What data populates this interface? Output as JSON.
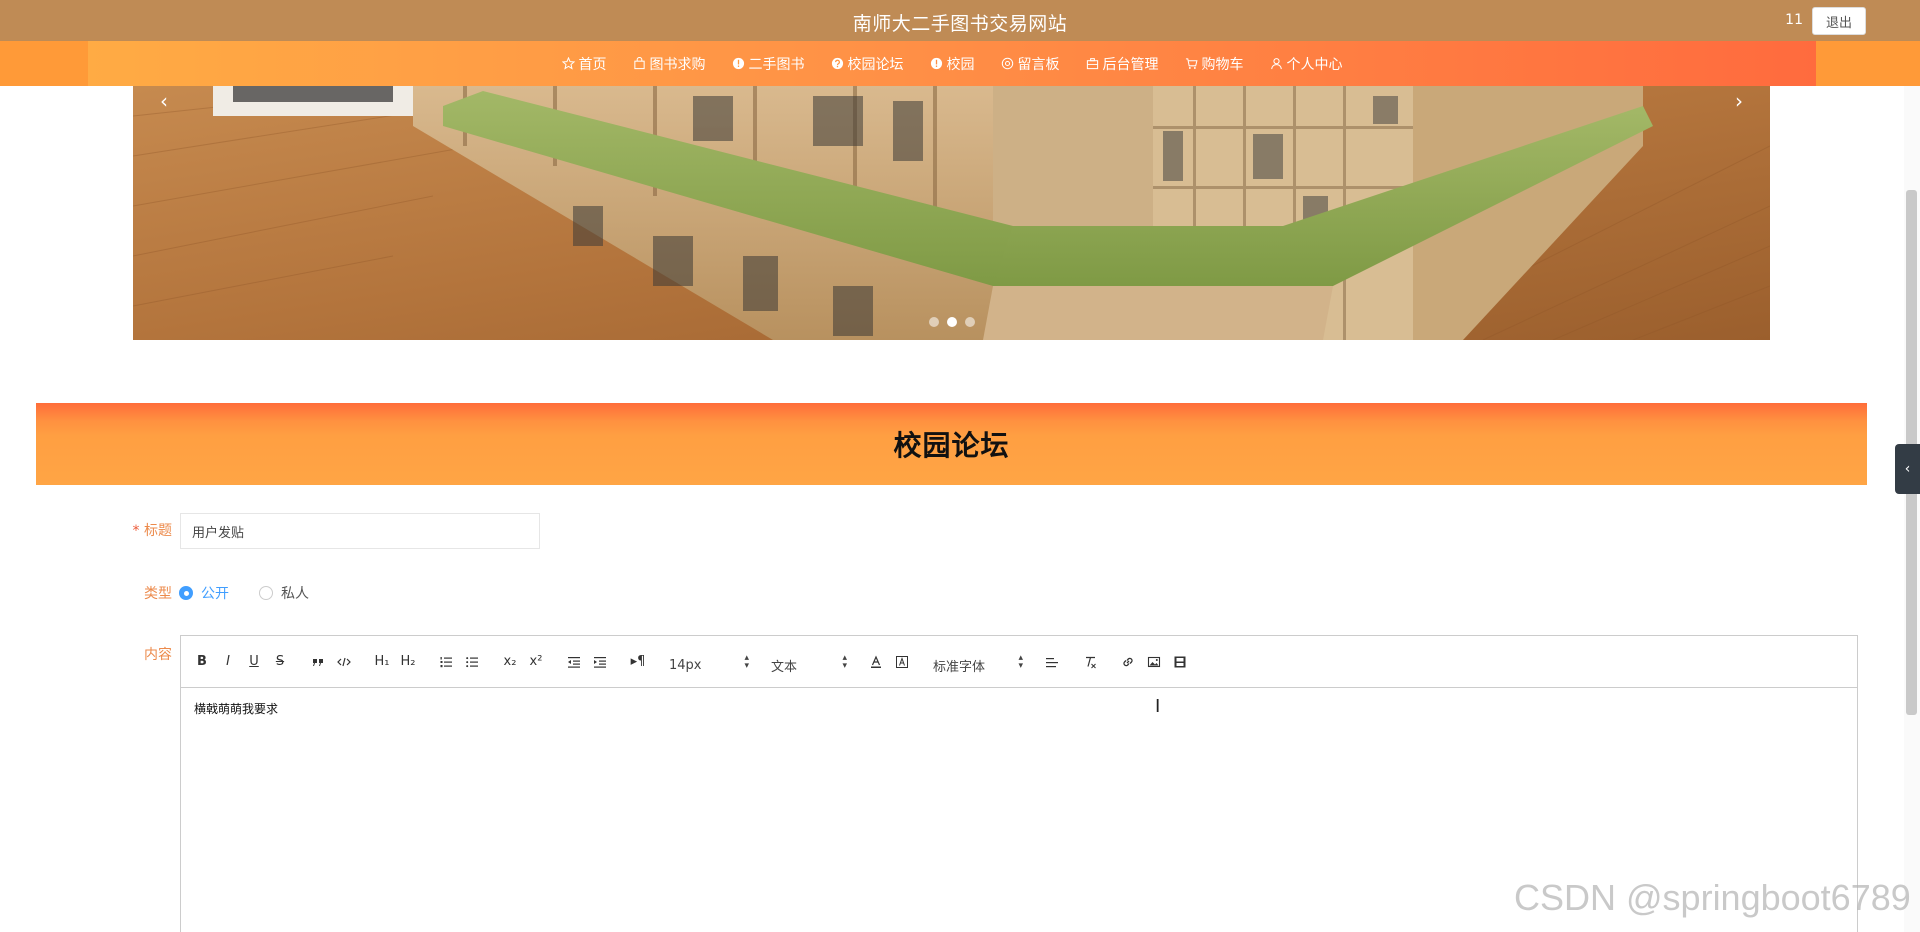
{
  "header": {
    "site_title": "南师大二手图书交易网站",
    "user_name": "11",
    "logout_label": "退出"
  },
  "nav": {
    "items": [
      {
        "label": "首页",
        "icon": "star-icon"
      },
      {
        "label": "图书求购",
        "icon": "bag-icon"
      },
      {
        "label": "二手图书",
        "icon": "info-icon"
      },
      {
        "label": "校园论坛",
        "icon": "help-icon"
      },
      {
        "label": "校园",
        "icon": "info-icon"
      },
      {
        "label": "留言板",
        "icon": "at-icon"
      },
      {
        "label": "后台管理",
        "icon": "briefcase-icon"
      },
      {
        "label": "购物车",
        "icon": "cart-icon"
      },
      {
        "label": "个人中心",
        "icon": "user-icon"
      }
    ]
  },
  "banner": {
    "prev": "‹",
    "next": "›",
    "slide_count": 3,
    "active_slide": 2
  },
  "section": {
    "title": "校园论坛"
  },
  "form": {
    "title_label_required": "*",
    "title_label": "标题",
    "title_value": "用户发贴",
    "type_label": "类型",
    "type_options": [
      {
        "label": "公开",
        "checked": true
      },
      {
        "label": "私人",
        "checked": false
      }
    ],
    "content_label": "内容",
    "content_text": "横戟萌萌我要求"
  },
  "editor_toolbar": {
    "bold": "B",
    "italic": "I",
    "underline": "U",
    "strike": "S",
    "h1": "H₁",
    "h2": "H₂",
    "sub": "x₂",
    "sup": "x²",
    "direction": "▸¶",
    "font_size": "14px",
    "text_type": "文本",
    "font_family": "标准字体"
  },
  "side": {
    "toggle": "‹"
  },
  "watermark": "CSDN @springboot6789",
  "colors": {
    "topbar": "#bf8b55",
    "nav": "#ff9a38",
    "accent_label": "#ec8a4b",
    "radio_checked": "#409eff"
  }
}
